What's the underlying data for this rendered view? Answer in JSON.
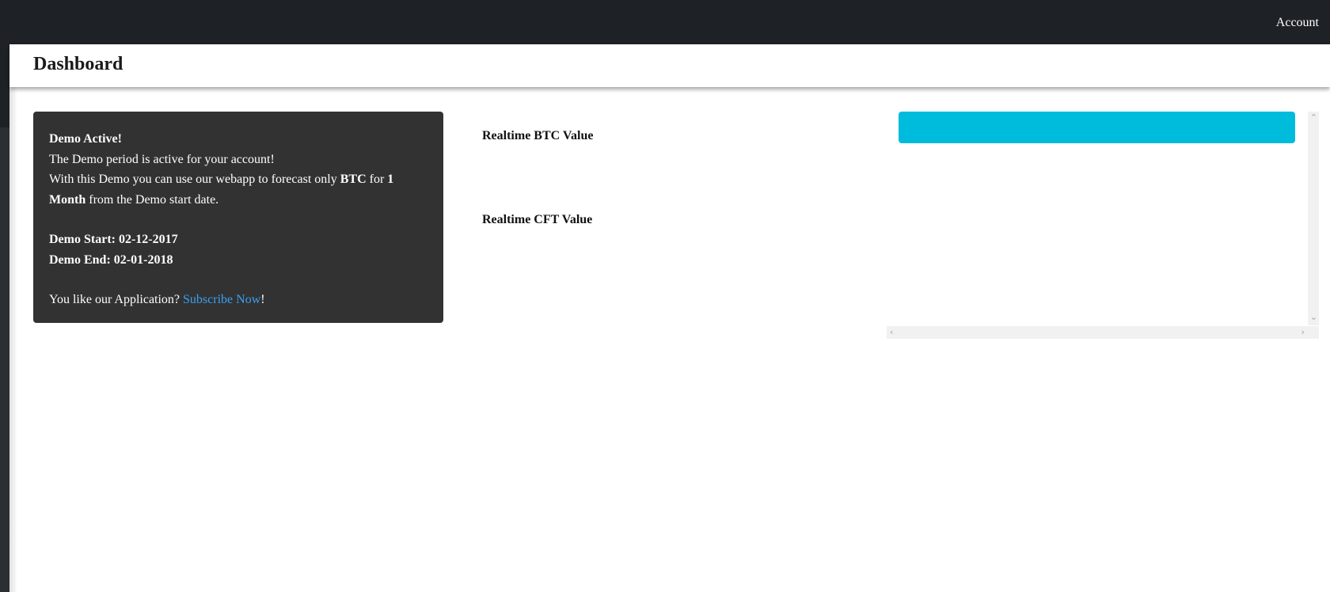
{
  "topbar": {
    "account_label": "Account"
  },
  "header": {
    "title": "Dashboard"
  },
  "demo_card": {
    "heading": "Demo Active!",
    "line1": "The Demo period is active for your account!",
    "line2_prefix": "With this Demo you can use our webapp to forecast only ",
    "line2_coin": "BTC",
    "line2_mid": " for ",
    "line2_duration": "1 Month",
    "line2_suffix": " from the Demo start date.",
    "start_label": "Demo Start:",
    "start_value": "02-12-2017",
    "end_label": "Demo End:",
    "end_value": "02-01-2018",
    "cta_prefix": "You like our Application? ",
    "cta_link": "Subscribe Now",
    "cta_suffix": "!"
  },
  "realtime": {
    "btc_label": "Realtime BTC Value",
    "cft_label": "Realtime CFT Value"
  },
  "widget": {
    "bar_color": "#00bcdc"
  },
  "icons": {
    "scroll_up": "chevron-up-icon",
    "scroll_down": "chevron-down-icon",
    "scroll_left": "chevron-left-icon",
    "scroll_right": "chevron-right-icon"
  },
  "colors": {
    "topbar": "#1e2226",
    "card": "#323232",
    "link": "#3aa0f0"
  }
}
